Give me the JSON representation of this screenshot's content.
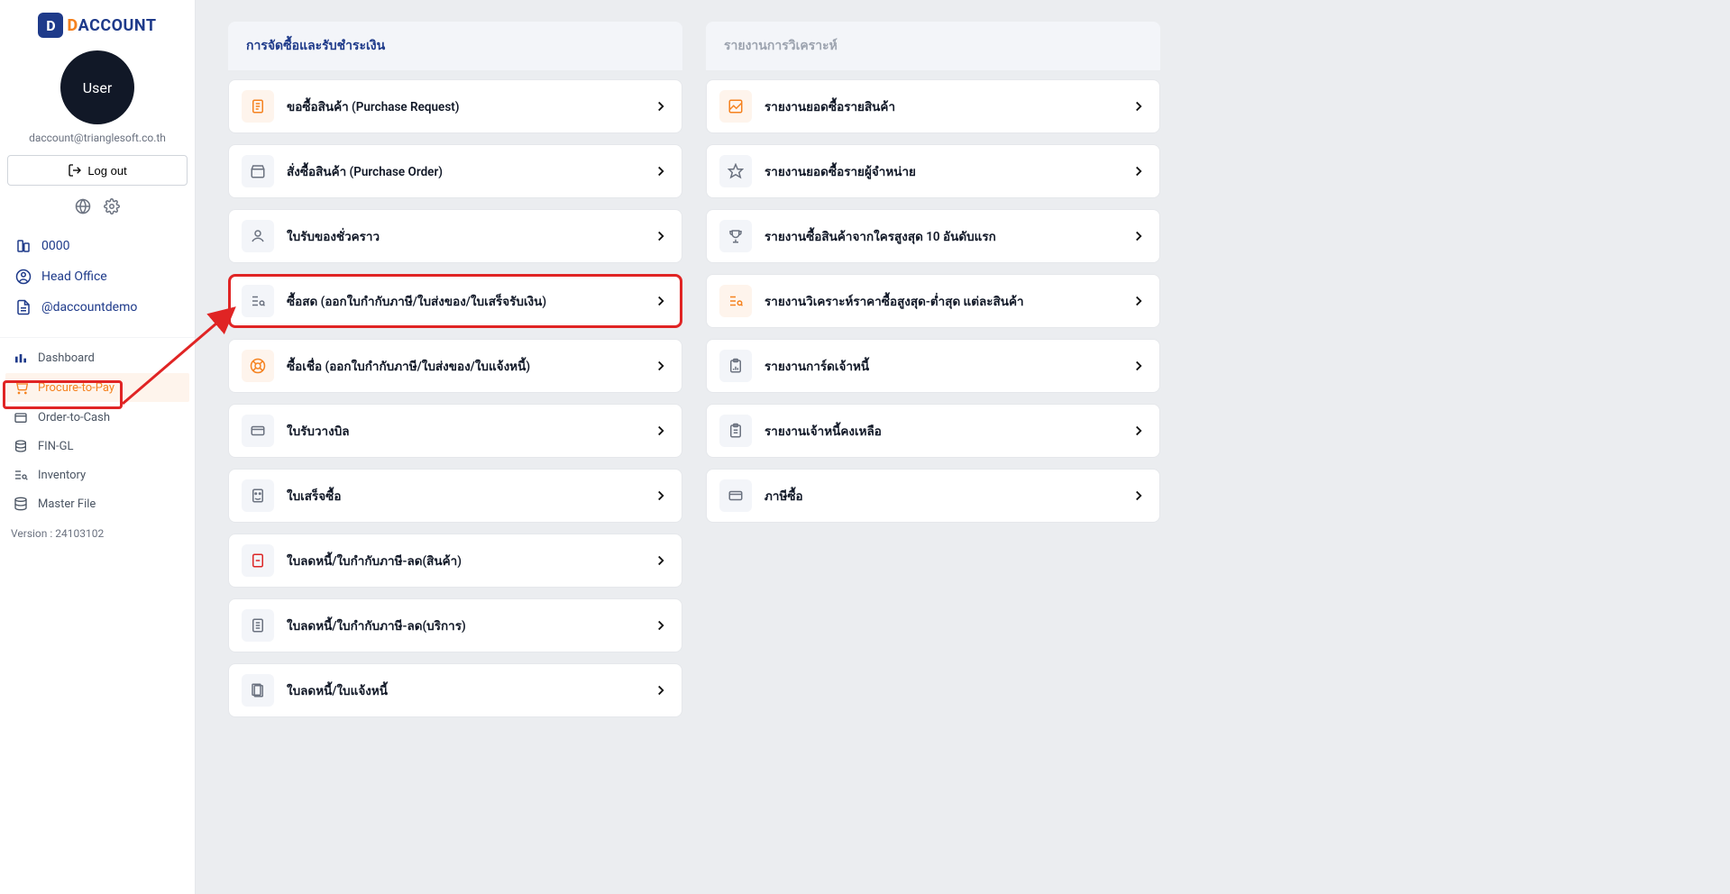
{
  "brand": {
    "logo_text": "ACCOUNT",
    "logo_d": "D"
  },
  "user": {
    "avatar_label": "User",
    "email": "daccount@trianglesoft.co.th",
    "logout_label": "Log out"
  },
  "sidebar_info": {
    "org_code": "0000",
    "office": "Head Office",
    "handle": "@daccountdemo"
  },
  "nav": {
    "dashboard": "Dashboard",
    "procure_to_pay": "Procure-to-Pay",
    "order_to_cash": "Order-to-Cash",
    "fin_gl": "FIN-GL",
    "inventory": "Inventory",
    "master_file": "Master File"
  },
  "version": "Version : 24103102",
  "columns": {
    "left": {
      "header": "การจัดซื้อและรับชำระเงิน",
      "items": [
        "ขอซื้อสินค้า (Purchase Request)",
        "สั่งซื้อสินค้า (Purchase Order)",
        "ใบรับของชั่วคราว",
        "ซื้อสด (ออกใบกำกับภาษี/ใบส่งของ/ใบเสร็จรับเงิน)",
        "ซื้อเชื่อ (ออกใบกำกับภาษี/ใบส่งของ/ใบแจ้งหนี้)",
        "ใบรับวางบิล",
        "ใบเสร็จซื้อ",
        "ใบลดหนี้/ใบกำกับภาษี-ลด(สินค้า)",
        "ใบลดหนี้/ใบกำกับภาษี-ลด(บริการ)",
        "ใบลดหนี้/ใบแจ้งหนี้"
      ]
    },
    "right": {
      "header": "รายงานการวิเคราะห์",
      "items": [
        "รายงานยอดซื้อรายสินค้า",
        "รายงานยอดซื้อรายผู้จำหน่าย",
        "รายงานซื้อสินค้าจากใครสูงสุด 10 อันดับแรก",
        "รายงานวิเคราะห์ราคาซื้อสูงสุด-ต่ำสุด แต่ละสินค้า",
        "รายงานการ์ดเจ้าหนี้",
        "รายงานเจ้าหนี้คงเหลือ",
        "ภาษีซื้อ"
      ]
    }
  }
}
